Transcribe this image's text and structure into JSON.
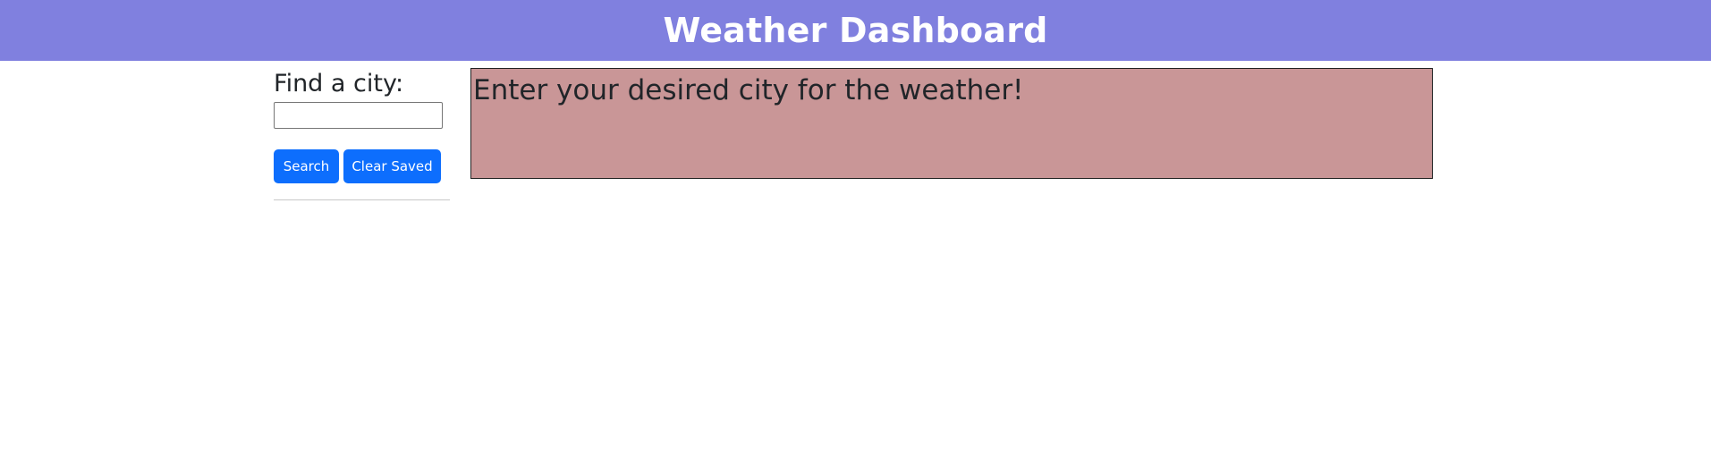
{
  "header": {
    "title": "Weather Dashboard"
  },
  "sidebar": {
    "heading": "Find a city:",
    "search_input": {
      "value": "",
      "placeholder": ""
    },
    "buttons": {
      "search_label": "Search",
      "clear_label": "Clear Saved"
    },
    "saved_cities": []
  },
  "main": {
    "message": "Enter your desired city for the weather!"
  },
  "colors": {
    "header_bg": "#8080df",
    "button_bg": "#0d6efd",
    "message_box_bg": "#c99697"
  }
}
